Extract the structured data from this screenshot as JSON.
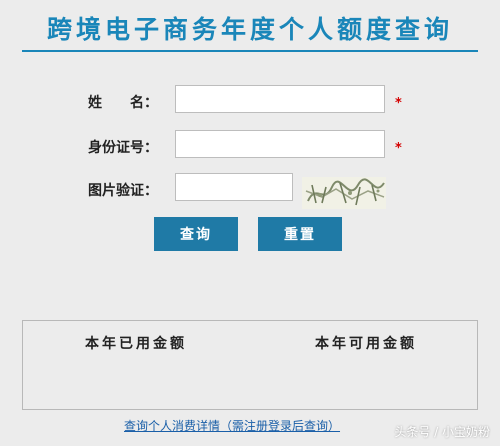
{
  "page": {
    "title": "跨境电子商务年度个人额度查询"
  },
  "form": {
    "name_label": "姓　　名：",
    "id_label": "身份证号：",
    "captcha_label": "图片验证：",
    "required_mark": "*",
    "name_value": "",
    "id_value": "",
    "captcha_value": ""
  },
  "buttons": {
    "query": "查询",
    "reset": "重置"
  },
  "results": {
    "used_label": "本年已用金额",
    "available_label": "本年可用金额"
  },
  "footer": {
    "detail_link": "查询个人消费详情（需注册登录后查询）",
    "watermark": "头条号 / 小宝奶粉"
  },
  "colors": {
    "accent": "#1a86b9",
    "button": "#1f7aa6",
    "required": "#d40000"
  }
}
